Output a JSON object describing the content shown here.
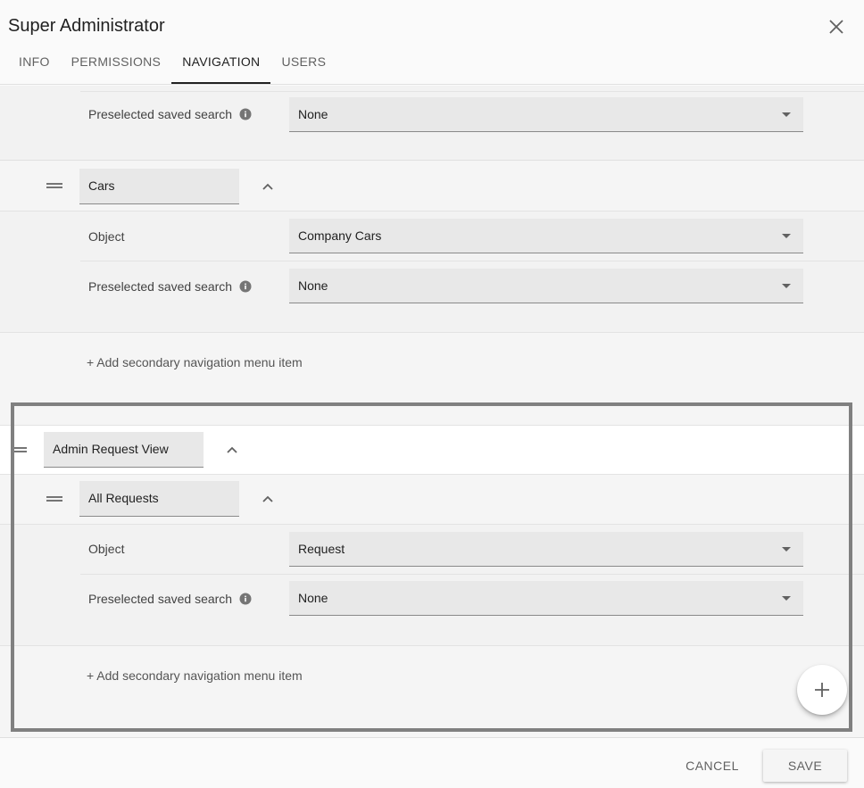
{
  "dialog": {
    "title": "Super Administrator"
  },
  "tabs": [
    {
      "label": "INFO"
    },
    {
      "label": "PERMISSIONS"
    },
    {
      "label": "NAVIGATION"
    },
    {
      "label": "USERS"
    }
  ],
  "active_tab": "NAVIGATION",
  "navigation": {
    "top_section": {
      "preselected_label": "Preselected saved search",
      "preselected_value": "None"
    },
    "cars": {
      "name": "Cars",
      "object_label": "Object",
      "object_value": "Company Cars",
      "preselected_label": "Preselected saved search",
      "preselected_value": "None",
      "add_link": "+ Add secondary navigation menu item"
    },
    "admin": {
      "name": "Admin Request View",
      "child": {
        "name": "All Requests",
        "object_label": "Object",
        "object_value": "Request",
        "preselected_label": "Preselected saved search",
        "preselected_value": "None"
      },
      "add_link": "+ Add secondary navigation menu item"
    }
  },
  "footer": {
    "cancel": "CANCEL",
    "save": "SAVE"
  },
  "colors": {
    "highlight_border": "#808080",
    "primary_text": "#212121",
    "field_bg": "#e8e8e8"
  }
}
